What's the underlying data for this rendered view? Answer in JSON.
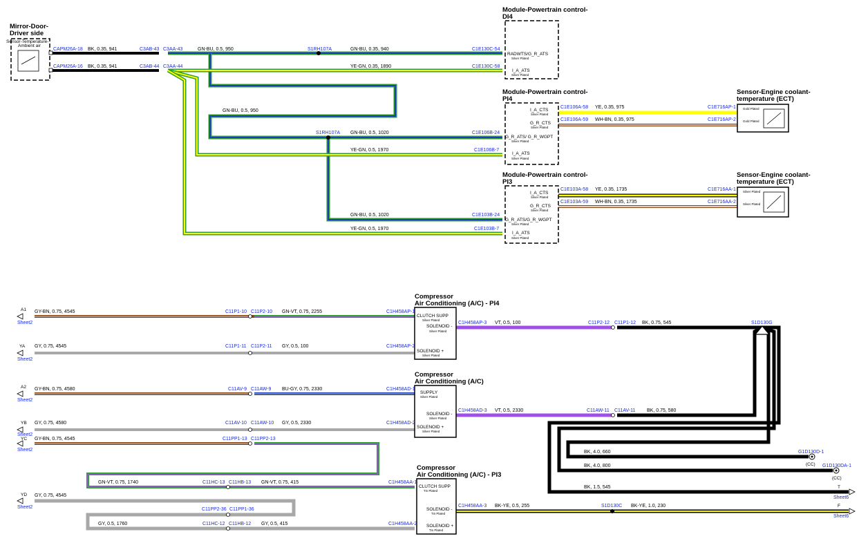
{
  "colors": {
    "connector_text": "#1a2bd9",
    "BK": "#000000",
    "GN": "#2e9c2e",
    "BU": "#1b3fb8",
    "YE": "#ffff00",
    "BN": "#8b4513",
    "WH": "#ffffff",
    "GY": "#a8a8a8",
    "VT": "#a050e8"
  },
  "components": {
    "mirror": {
      "title1": "Mirror-Door-",
      "title2": "Driver side",
      "sub1": "Sensor-Temperature-",
      "sub2": "Ambient air"
    },
    "pcm_di4": {
      "title1": "Module-Powertrain control-",
      "title2": "DI4",
      "pins": [
        {
          "label": "RADWTS/G_R_ATS",
          "plating": "Silver Plated"
        },
        {
          "label": "I_A_ATS",
          "plating": "Silver Plated"
        }
      ]
    },
    "pcm_pi4": {
      "title1": "Module-Powertrain control-",
      "title2": "PI4",
      "pins": [
        {
          "label": "I_A_CTS",
          "plating": "Silver Plated"
        },
        {
          "label": "G_R_CTS",
          "plating": "Silver Plated"
        },
        {
          "label": "G_R_ATS/ G_R_WGPT",
          "plating": "Silver Plated"
        },
        {
          "label": "I_A_ATS",
          "plating": "Silver Plated"
        }
      ]
    },
    "pcm_pi3": {
      "title1": "Module-Powertrain control-",
      "title2": "PI3",
      "pins": [
        {
          "label": "I_A_CTS",
          "plating": "Silver Plated"
        },
        {
          "label": "G_R_CTS",
          "plating": "Silver Plated"
        },
        {
          "label": "G_R_ATS/G_R_WGPT",
          "plating": "Silver Plated"
        },
        {
          "label": "I_A_ATS",
          "plating": "Silver Plated"
        }
      ]
    },
    "ect1": {
      "title1": "Sensor-Engine coolant-",
      "title2": "temperature (ECT)",
      "plating1": "Gold Plated",
      "plating2": "Gold Plated"
    },
    "ect2": {
      "title1": "Sensor-Engine coolant-",
      "title2": "temperature (ECT)",
      "plating1": "Silver Plated",
      "plating2": "Silver Plated"
    },
    "comp_pi4": {
      "title1": "Compressor",
      "title2": "Air Conditioning (A/C) - PI4",
      "pins": [
        {
          "label": "CLUTCH SUPP",
          "plating": "Silver Plated"
        },
        {
          "label": "SOLENOID -",
          "plating": "Silver Plated"
        },
        {
          "label": "SOLENOID +",
          "plating": "Silver Plated"
        }
      ]
    },
    "comp_ac": {
      "title1": "Compressor",
      "title2": "Air Conditioning (A/C)",
      "pins": [
        {
          "label": "SUPPLY",
          "plating": "Silver Plated"
        },
        {
          "label": "SOLENOID -",
          "plating": "Silver Plated"
        },
        {
          "label": "SOLENOID +",
          "plating": "Silver Plated"
        }
      ]
    },
    "comp_pi3": {
      "title1": "Compressor",
      "title2": "Air Conditioning (A/C) - PI3",
      "pins": [
        {
          "label": "CLUTCH SUPP",
          "plating": "Tin Plated"
        },
        {
          "label": "SOLENOID -",
          "plating": "Tin Plated"
        },
        {
          "label": "SOLENOID +",
          "plating": "Tin Plated"
        }
      ]
    }
  },
  "connectors": {
    "capm18": "CAPM26A-18",
    "capm16": "CAPM26A-16",
    "c3ab43": "C3AB-43",
    "c3aa43": "C3AA-43",
    "c3ab44": "C3AB-44",
    "c3aa44": "C3AA-44",
    "s1rh_top": "S1RH107A",
    "s1rh_mid": "S1RH107A",
    "c1e130c54": "C1E130C-54",
    "c1e130c58": "C1E130C-58",
    "c1e106a58": "C1E106A-58",
    "c1e106a59": "C1E106A-59",
    "c1e716ap1": "C1E716AP-1",
    "c1e716ap2": "C1E716AP-2",
    "c1e106b24": "C1E106B-24",
    "c1e106b7": "C1E106B-7",
    "c1e103a58": "C1E103A-58",
    "c1e103a59": "C1E103A-59",
    "c1e716aa1": "C1E716AA-1",
    "c1e716aa2": "C1E716AA-2",
    "c1e103b24": "C1E103B-24",
    "c1e103b7": "C1E103B-7",
    "c11p1_10": "C11P1-10",
    "c11p2_10": "C11P2-10",
    "c1h458ap1": "C1H458AP-1",
    "c1h458ap3": "C1H458AP-3",
    "c11p2_12": "C11P2-12",
    "c11p1_12": "C11P1-12",
    "s1d130g": "S1D130G",
    "c11p1_11": "C11P1-11",
    "c11p2_11": "C11P2-11",
    "c1h458ap2": "C1H458AP-2",
    "c11av9": "C11AV-9",
    "c11aw9": "C11AW-9",
    "c1h458ad1": "C1H458AD-1",
    "c1h458ad3": "C1H458AD-3",
    "c11aw11": "C11AW-11",
    "c11av11": "C11AV-11",
    "c11av10": "C11AV-10",
    "c11aw10": "C11AW-10",
    "c1h458ad2": "C1H458AD-2",
    "c11pp1_13": "C11PP1-13",
    "c11pp2_13": "C11PP2-13",
    "c11hc13": "C11HC-13",
    "c11hb13": "C11HB-13",
    "c1h458aa1": "C1H458AA-1",
    "c11pp2_36": "C11PP2-36",
    "c11pp1_36": "C11PP1-36",
    "c1h458aa3": "C1H458AA-3",
    "s1d130c": "S1D130C",
    "c11hc12": "C11HC-12",
    "c11hb12": "C11HB-12",
    "c1h458aa2": "C1H458AA-2",
    "g1d130d1": "G1D130D-1",
    "g1d130da1": "G1D130DA-1"
  },
  "wires": {
    "w_capm18": "BK, 0.35, 941",
    "w_capm16": "BK, 0.35, 941",
    "w_gnbu950_top": "GN-BU, 0.5, 950",
    "w_gnbu940": "GN-BU, 0.35, 940",
    "w_yegn1890": "YE-GN, 0.35, 1890",
    "w_gnbu950_mid": "GN-BU, 0.5, 950",
    "w_gnbu1020_a": "GN-BU, 0.5, 1020",
    "w_yegn1970_a": "YE-GN, 0.5, 1970",
    "w_ye975": "YE, 0.35, 975",
    "w_whbn975": "WH-BN, 0.35, 975",
    "w_ye1735": "YE, 0.35, 1735",
    "w_whbn1735": "WH-BN, 0.35, 1735",
    "w_gnbu1020_b": "GN-BU, 0.5, 1020",
    "w_yegn1970_b": "YE-GN, 0.5, 1970",
    "w_gybn4545_a": "GY-BN, 0.75, 4545",
    "w_gnvt2255": "GN-VT, 0.75, 2255",
    "w_vt100": "VT, 0.5, 100",
    "w_bk545_a": "BK, 0.75, 545",
    "w_gy4545_a": "GY, 0.75, 4545",
    "w_gy100": "GY, 0.5, 100",
    "w_gybn4580": "GY-BN, 0.75, 4580",
    "w_bugy2330": "BU-GY, 0.75, 2330",
    "w_vt2330": "VT, 0.5, 2330",
    "w_bk580": "BK, 0.75, 580",
    "w_gy4580": "GY, 0.75, 4580",
    "w_gy2330": "GY, 0.5, 2330",
    "w_gybn4545_b": "GY-BN, 0.75, 4545",
    "w_gnvt1740": "GN-VT, 0.75, 1740",
    "w_gnvt415": "GN-VT, 0.75, 415",
    "w_bk660": "BK, 4.0, 660",
    "w_bk800": "BK, 4.0, 800",
    "w_gy4545_b": "GY, 0.75, 4545",
    "w_bkye255": "BK-YE, 0.5, 255",
    "w_bkye230": "BK-YE, 1.0, 230",
    "w_bk545_b": "BK, 1.5, 545",
    "w_gy1760": "GY, 0.5, 1760",
    "w_gy415": "GY, 0.5, 415"
  },
  "sheet_refs": {
    "a1": {
      "id": "A1",
      "sheet": "Sheet2"
    },
    "ya": {
      "id": "YA",
      "sheet": "Sheet2"
    },
    "a2": {
      "id": "A2",
      "sheet": "Sheet2"
    },
    "yb": {
      "id": "YB",
      "sheet": "Sheet2"
    },
    "yc": {
      "id": "YC",
      "sheet": "Sheet2"
    },
    "yd": {
      "id": "YD",
      "sheet": "Sheet2"
    },
    "t": {
      "id": "T",
      "sheet": "Sheet6"
    },
    "f": {
      "id": "F",
      "sheet": "Sheet6"
    }
  },
  "grounds": {
    "g1": "(CC)",
    "g2": "(CC)"
  }
}
